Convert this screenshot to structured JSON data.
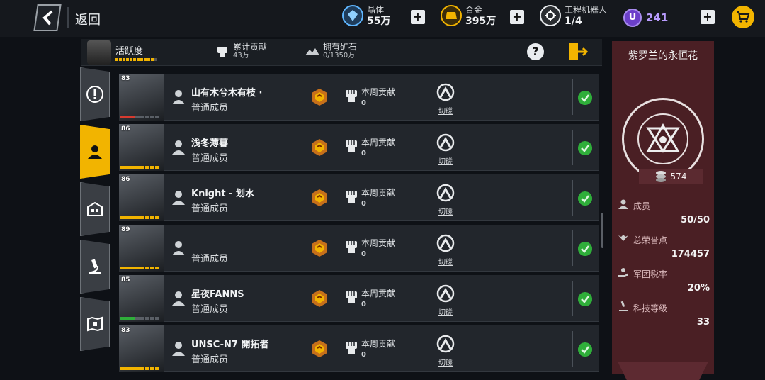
{
  "topbar": {
    "back_label": "返回",
    "resources": [
      {
        "icon": "crystal-icon",
        "label": "晶体",
        "value": "55万",
        "color": "#5fb6ff"
      },
      {
        "icon": "alloy-icon",
        "label": "合金",
        "value": "395万",
        "color": "#f2b400"
      },
      {
        "icon": "robot-icon",
        "label": "工程机器人",
        "value": "1/4",
        "color": "#e9ecef"
      }
    ],
    "premium_letter": "U",
    "premium_value": "241",
    "plus_label": "+"
  },
  "stats": {
    "activity_label": "活跃度",
    "contribution_label": "累计贡献",
    "contribution_value": "43万",
    "ore_label": "拥有矿石",
    "ore_value": "0/1350万",
    "help_label": "?"
  },
  "members": [
    {
      "level": "83",
      "name": "山有木兮木有枝 ·",
      "role": "普通成员",
      "week_label": "本周贡献",
      "week_value": "0",
      "spar_label": "切磋",
      "hp": "red"
    },
    {
      "level": "86",
      "name": "浅冬薄暮",
      "role": "普通成员",
      "week_label": "本周贡献",
      "week_value": "0",
      "spar_label": "切磋",
      "hp": "yellow"
    },
    {
      "level": "86",
      "name": "Knight - 划水",
      "role": "普通成员",
      "week_label": "本周贡献",
      "week_value": "0",
      "spar_label": "切磋",
      "hp": "yellow"
    },
    {
      "level": "89",
      "name": "",
      "role": "普通成员",
      "week_label": "本周贡献",
      "week_value": "0",
      "spar_label": "切磋",
      "hp": "yellow"
    },
    {
      "level": "85",
      "name": "星夜FANNS",
      "role": "普通成员",
      "week_label": "本周贡献",
      "week_value": "0",
      "spar_label": "切磋",
      "hp": "green"
    },
    {
      "level": "83",
      "name": "UNSC-N7 開拓者",
      "role": "普通成员",
      "week_label": "本周贡献",
      "week_value": "0",
      "spar_label": "切磋",
      "hp": "yellow"
    }
  ],
  "legion": {
    "name": "紫罗兰的永恒花",
    "coins": "574",
    "members_label": "成员",
    "members_value": "50/50",
    "honor_label": "总荣誉点",
    "honor_value": "174457",
    "tax_label": "军团税率",
    "tax_value": "20%",
    "tech_label": "科技等级",
    "tech_value": "33"
  },
  "colors": {
    "accent": "#f2b400",
    "panel": "#4a1f24",
    "row": "#22262c",
    "online": "#2fae3a"
  }
}
